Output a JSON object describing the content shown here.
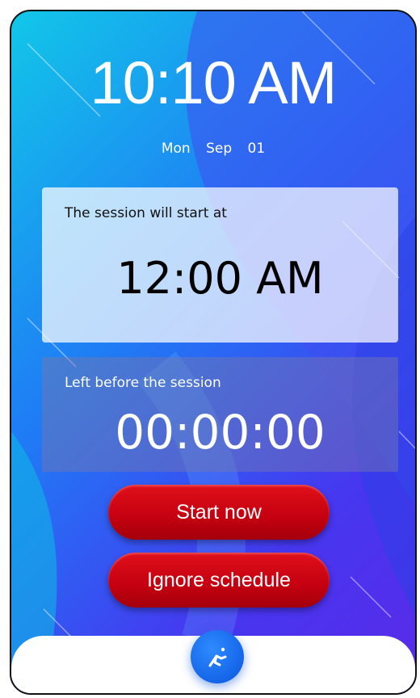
{
  "clock": {
    "time": "10:10 AM"
  },
  "date": {
    "weekday": "Mon",
    "month": "Sep",
    "day": "01"
  },
  "start_panel": {
    "label": "The session will start at",
    "time": "12:00 AM"
  },
  "left_panel": {
    "label": "Left before the session",
    "countdown": "00:00:00"
  },
  "buttons": {
    "start_now": "Start now",
    "ignore_schedule": "Ignore schedule"
  },
  "fab": {
    "icon": "runner-icon"
  },
  "colors": {
    "background_start": "#12c7e8",
    "background_end": "#5a2ae8",
    "button_red": "#c40010",
    "fab_blue": "#1565e8"
  }
}
